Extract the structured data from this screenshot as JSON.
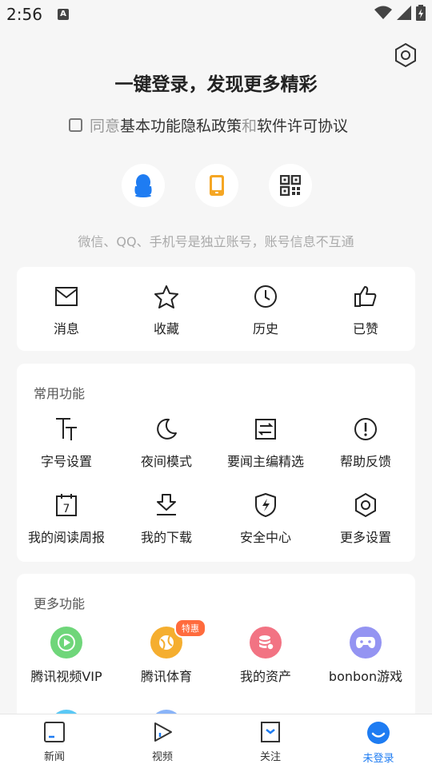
{
  "status_bar": {
    "time": "2:56",
    "notification_icon": "A",
    "icons": [
      "wifi-icon",
      "signal-icon",
      "battery-charging-icon"
    ]
  },
  "header": {
    "settings_icon": "hexagon-gear-icon",
    "headline": "一键登录，发现更多精彩"
  },
  "agreement": {
    "prefix": "同意",
    "link1": "基本功能隐私政策",
    "and": "和",
    "link2": "软件许可协议"
  },
  "login_methods": [
    {
      "name": "qq",
      "icon": "qq-penguin-icon",
      "color": "#1e7cf2"
    },
    {
      "name": "phone",
      "icon": "phone-icon",
      "color": "#f5a623"
    },
    {
      "name": "qrcode",
      "icon": "qrcode-icon",
      "color": "#333333"
    }
  ],
  "login_note": "微信、QQ、手机号是独立账号，账号信息不互通",
  "quick_actions": [
    {
      "label": "消息",
      "icon": "mail-icon"
    },
    {
      "label": "收藏",
      "icon": "star-icon"
    },
    {
      "label": "历史",
      "icon": "clock-icon"
    },
    {
      "label": "已赞",
      "icon": "thumbs-up-icon"
    }
  ],
  "common": {
    "title": "常用功能",
    "items": [
      {
        "label": "字号设置",
        "icon": "font-size-icon"
      },
      {
        "label": "夜间模式",
        "icon": "moon-icon"
      },
      {
        "label": "要闻主编精选",
        "icon": "swap-doc-icon"
      },
      {
        "label": "帮助反馈",
        "icon": "alert-circle-icon"
      },
      {
        "label": "我的阅读周报",
        "icon": "calendar-icon",
        "calendar_day": "7"
      },
      {
        "label": "我的下载",
        "icon": "download-icon"
      },
      {
        "label": "安全中心",
        "icon": "shield-bolt-icon"
      },
      {
        "label": "更多设置",
        "icon": "hexagon-gear-icon"
      }
    ]
  },
  "more": {
    "title": "更多功能",
    "items": [
      {
        "label": "腾讯视频VIP",
        "icon": "play-icon",
        "color": "#5fcf6a"
      },
      {
        "label": "腾讯体育",
        "icon": "ball-icon",
        "color": "#f5a623",
        "badge": "特惠"
      },
      {
        "label": "我的资产",
        "icon": "coins-icon",
        "color": "#f06a7a"
      },
      {
        "label": "bonbon游戏",
        "icon": "gamepad-icon",
        "color": "#8c8cf0"
      }
    ]
  },
  "tabbar": [
    {
      "label": "新闻",
      "icon": "news-icon"
    },
    {
      "label": "视频",
      "icon": "video-play-icon"
    },
    {
      "label": "关注",
      "icon": "bookmark-check-icon"
    },
    {
      "label": "未登录",
      "icon": "avatar-icon",
      "active": true
    }
  ],
  "accent": "#1e7cf2"
}
